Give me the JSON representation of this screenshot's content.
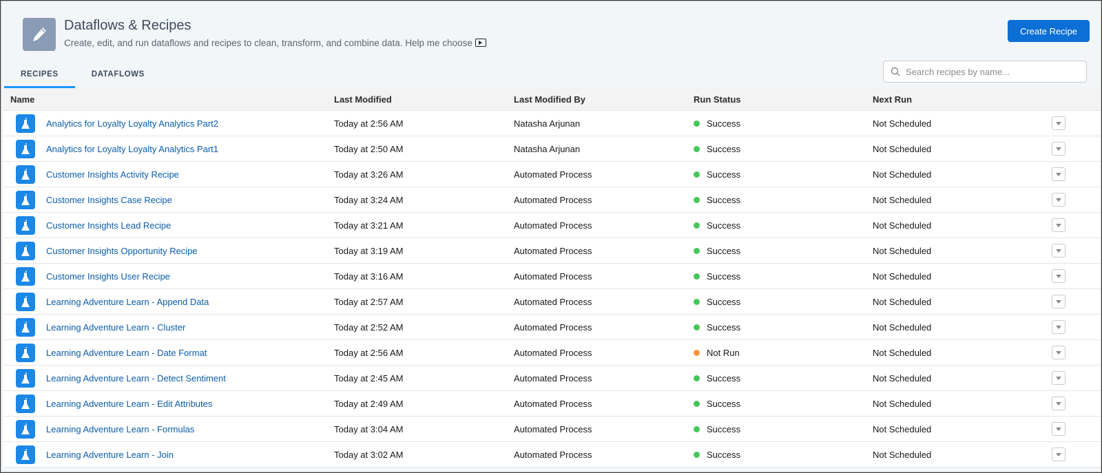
{
  "header": {
    "title": "Dataflows & Recipes",
    "subtitle": "Create, edit, and run dataflows and recipes to clean, transform, and combine data. Help me choose",
    "create_button": "Create Recipe",
    "app_icon": "pencil-icon"
  },
  "tabs": [
    {
      "label": "RECIPES",
      "active": true
    },
    {
      "label": "DATAFLOWS",
      "active": false
    }
  ],
  "search": {
    "placeholder": "Search recipes by name...",
    "value": ""
  },
  "colors": {
    "accent": "#0b6fd6",
    "link": "#0b5cab",
    "success": "#45c65a",
    "not_run": "#fe9339",
    "recipe_icon": "#1b87e6"
  },
  "table": {
    "columns": [
      "Name",
      "Last Modified",
      "Last Modified By",
      "Run Status",
      "Next Run"
    ],
    "rows": [
      {
        "name": "Analytics for Loyalty Loyalty Analytics Part2",
        "modified": "Today at 2:56 AM",
        "by": "Natasha Arjunan",
        "status": "Success",
        "status_color": "#45c65a",
        "next": "Not Scheduled"
      },
      {
        "name": "Analytics for Loyalty Loyalty Analytics Part1",
        "modified": "Today at 2:50 AM",
        "by": "Natasha Arjunan",
        "status": "Success",
        "status_color": "#45c65a",
        "next": "Not Scheduled"
      },
      {
        "name": "Customer Insights Activity Recipe",
        "modified": "Today at 3:26 AM",
        "by": "Automated Process",
        "status": "Success",
        "status_color": "#45c65a",
        "next": "Not Scheduled"
      },
      {
        "name": "Customer Insights Case Recipe",
        "modified": "Today at 3:24 AM",
        "by": "Automated Process",
        "status": "Success",
        "status_color": "#45c65a",
        "next": "Not Scheduled"
      },
      {
        "name": "Customer Insights Lead Recipe",
        "modified": "Today at 3:21 AM",
        "by": "Automated Process",
        "status": "Success",
        "status_color": "#45c65a",
        "next": "Not Scheduled"
      },
      {
        "name": "Customer Insights Opportunity Recipe",
        "modified": "Today at 3:19 AM",
        "by": "Automated Process",
        "status": "Success",
        "status_color": "#45c65a",
        "next": "Not Scheduled"
      },
      {
        "name": "Customer Insights User Recipe",
        "modified": "Today at 3:16 AM",
        "by": "Automated Process",
        "status": "Success",
        "status_color": "#45c65a",
        "next": "Not Scheduled"
      },
      {
        "name": "Learning Adventure Learn - Append Data",
        "modified": "Today at 2:57 AM",
        "by": "Automated Process",
        "status": "Success",
        "status_color": "#45c65a",
        "next": "Not Scheduled"
      },
      {
        "name": "Learning Adventure Learn - Cluster",
        "modified": "Today at 2:52 AM",
        "by": "Automated Process",
        "status": "Success",
        "status_color": "#45c65a",
        "next": "Not Scheduled"
      },
      {
        "name": "Learning Adventure Learn - Date Format",
        "modified": "Today at 2:56 AM",
        "by": "Automated Process",
        "status": "Not Run",
        "status_color": "#fe9339",
        "next": "Not Scheduled"
      },
      {
        "name": "Learning Adventure Learn - Detect Sentiment",
        "modified": "Today at 2:45 AM",
        "by": "Automated Process",
        "status": "Success",
        "status_color": "#45c65a",
        "next": "Not Scheduled"
      },
      {
        "name": "Learning Adventure Learn - Edit Attributes",
        "modified": "Today at 2:49 AM",
        "by": "Automated Process",
        "status": "Success",
        "status_color": "#45c65a",
        "next": "Not Scheduled"
      },
      {
        "name": "Learning Adventure Learn - Formulas",
        "modified": "Today at 3:04 AM",
        "by": "Automated Process",
        "status": "Success",
        "status_color": "#45c65a",
        "next": "Not Scheduled"
      },
      {
        "name": "Learning Adventure Learn - Join",
        "modified": "Today at 3:02 AM",
        "by": "Automated Process",
        "status": "Success",
        "status_color": "#45c65a",
        "next": "Not Scheduled"
      }
    ]
  }
}
